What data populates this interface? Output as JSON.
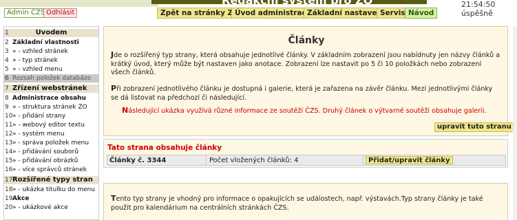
{
  "header": {
    "title": "Redakční systém pro ZO",
    "admin_label": "Admin ČZS",
    "logout_label": "Odhlásit",
    "nav": [
      {
        "label": "Zpět na stránky ZO"
      },
      {
        "label": "Úvod administrace"
      },
      {
        "label": "Základní nastavení"
      },
      {
        "label": "Servis"
      },
      {
        "label": "Návod"
      }
    ],
    "time": "21:54:50",
    "status": "úspěšně"
  },
  "sidebar": {
    "items": [
      {
        "num": "1",
        "label": "Úvodem",
        "type": "h1"
      },
      {
        "num": "2",
        "label": "Základní vlastnosti",
        "type": "h2"
      },
      {
        "num": "3",
        "label": "» - vzhled stránek",
        "type": "item"
      },
      {
        "num": "4",
        "label": "» - typ stránek",
        "type": "item"
      },
      {
        "num": "5",
        "label": "» - vzhled menu",
        "type": "item"
      },
      {
        "num": "6",
        "label": "Rozsah položek databáze",
        "type": "hl"
      },
      {
        "num": "7",
        "label": "Zřízení webstránek",
        "type": "bar"
      },
      {
        "num": "8",
        "label": "Administrace obsahu",
        "type": "h2"
      },
      {
        "num": "9",
        "label": "» - struktura stránek ZO",
        "type": "item"
      },
      {
        "num": "10",
        "label": "» - přidání strany",
        "type": "item"
      },
      {
        "num": "11",
        "label": "» - webový editor textu",
        "type": "item"
      },
      {
        "num": "12",
        "label": "» - systém menu",
        "type": "item"
      },
      {
        "num": "13",
        "label": "» - správa položek menu",
        "type": "item"
      },
      {
        "num": "14",
        "label": "» - přidávání souborů",
        "type": "item"
      },
      {
        "num": "15",
        "label": "» - přidávání obrázků",
        "type": "item"
      },
      {
        "num": "16",
        "label": "» - více správců stránek",
        "type": "item"
      },
      {
        "num": "17",
        "label": "Rozšířené typy stran",
        "type": "bar"
      },
      {
        "num": "18",
        "label": "» - ukázka titulku do menu",
        "type": "item"
      },
      {
        "num": "19",
        "label": "Akce",
        "type": "h2"
      },
      {
        "num": "20",
        "label": "» - ukázkové akce",
        "type": "item"
      }
    ]
  },
  "main": {
    "title": "Články",
    "para1_cap": "J",
    "para1": "de o rozšířený typ strany, která obsahuje jednotlivé články. V základním zobrazení jsou nabídnuty jen názvy článků a krátký úvod, který může být nastaven jako anotace. Zobrazení lze nastavit po 5 či 10 položkách nebo zobrazení všech článků.",
    "para2_cap": "P",
    "para2": "ři zobrazení jednotlivého článku je dostupná i galerie, která je zařazena na závěr článku. Mezi jednotlivými články se dá listovat na předchozí či následující.",
    "para3_cap": "N",
    "para3": "ásledující ukázka využívá různé informace ze soutěží ČZS. Druhý článek o výtvarné soutěži obsahuje galerii.",
    "edit_button": "upravit tuto stranu"
  },
  "articles_panel": {
    "title": "Tato strana obsahuje články",
    "name": "Články č. 3344",
    "count_text": "Počet vložených článků: 4",
    "button": "Přidat/upravit články"
  },
  "bottom_panel": {
    "cap": "T",
    "text": "ento typ strany je vhodný pro informace o opakujících se událostech, např. výstavách.Typ strany články je také použit pro kalendárium na centrálních stránkách ČZS."
  }
}
